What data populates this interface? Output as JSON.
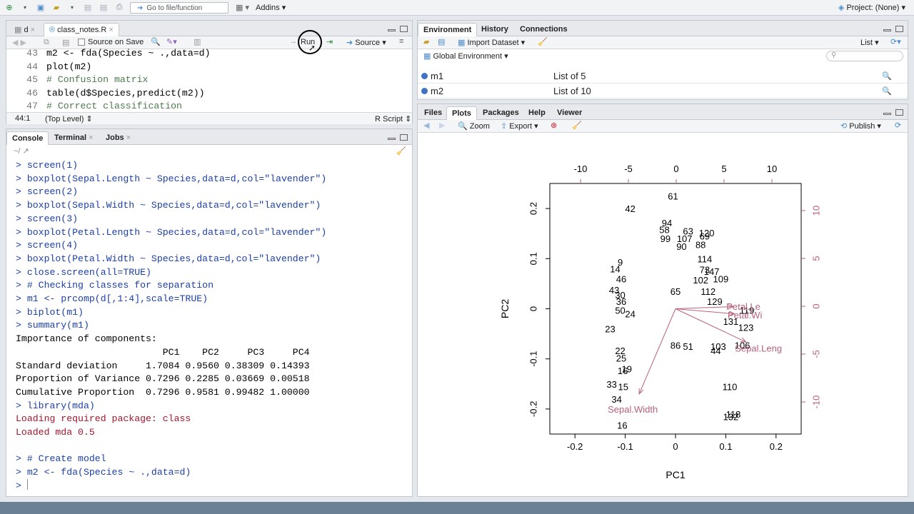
{
  "toolbar": {
    "goto_placeholder": "Go to file/function",
    "addins_label": "Addins",
    "project_label": "Project: (None)"
  },
  "editor": {
    "tabs": [
      {
        "label": "d"
      },
      {
        "label": "class_notes.R"
      }
    ],
    "source_on_save": "Source on Save",
    "run_label": "Run",
    "source_label": "Source",
    "lines": [
      {
        "num": "43",
        "text": "m2 <- fda(Species ~ .,data=d)"
      },
      {
        "num": "44",
        "text": "plot(m2)"
      },
      {
        "num": "45",
        "text": "# Confusion matrix"
      },
      {
        "num": "46",
        "text": "table(d$Species,predict(m2))"
      },
      {
        "num": "47",
        "text": "# Correct classification"
      }
    ],
    "status_pos": "44:1",
    "status_scope": "(Top Level)",
    "status_type": "R Script"
  },
  "console": {
    "tabs": [
      {
        "label": "Console"
      },
      {
        "label": "Terminal"
      },
      {
        "label": "Jobs"
      }
    ],
    "path": "~/",
    "lines": [
      {
        "kind": "in",
        "text": "> screen(1)"
      },
      {
        "kind": "in",
        "text": "> boxplot(Sepal.Length ~ Species,data=d,col=\"lavender\")"
      },
      {
        "kind": "in",
        "text": "> screen(2)"
      },
      {
        "kind": "in",
        "text": "> boxplot(Sepal.Width ~ Species,data=d,col=\"lavender\")"
      },
      {
        "kind": "in",
        "text": "> screen(3)"
      },
      {
        "kind": "in",
        "text": "> boxplot(Petal.Length ~ Species,data=d,col=\"lavender\")"
      },
      {
        "kind": "in",
        "text": "> screen(4)"
      },
      {
        "kind": "in",
        "text": "> boxplot(Petal.Width ~ Species,data=d,col=\"lavender\")"
      },
      {
        "kind": "in",
        "text": "> close.screen(all=TRUE)"
      },
      {
        "kind": "in",
        "text": "> # Checking classes for separation"
      },
      {
        "kind": "in",
        "text": "> m1 <- prcomp(d[,1:4],scale=TRUE)"
      },
      {
        "kind": "in",
        "text": "> biplot(m1)"
      },
      {
        "kind": "in",
        "text": "> summary(m1)"
      },
      {
        "kind": "out",
        "text": "Importance of components:"
      },
      {
        "kind": "out",
        "text": "                          PC1    PC2     PC3     PC4"
      },
      {
        "kind": "out",
        "text": "Standard deviation     1.7084 0.9560 0.38309 0.14393"
      },
      {
        "kind": "out",
        "text": "Proportion of Variance 0.7296 0.2285 0.03669 0.00518"
      },
      {
        "kind": "out",
        "text": "Cumulative Proportion  0.7296 0.9581 0.99482 1.00000"
      },
      {
        "kind": "in",
        "text": "> library(mda)"
      },
      {
        "kind": "msg",
        "text": "Loading required package: class"
      },
      {
        "kind": "msg",
        "text": "Loaded mda 0.5"
      },
      {
        "kind": "out",
        "text": ""
      },
      {
        "kind": "in",
        "text": "> # Create model"
      },
      {
        "kind": "in",
        "text": "> m2 <- fda(Species ~ .,data=d)"
      },
      {
        "kind": "in",
        "text": "> "
      }
    ]
  },
  "environment": {
    "tabs": [
      {
        "label": "Environment"
      },
      {
        "label": "History"
      },
      {
        "label": "Connections"
      }
    ],
    "import_label": "Import Dataset",
    "list_label": "List",
    "scope_label": "Global Environment",
    "rows": [
      {
        "name": "m1",
        "value": "List of 5"
      },
      {
        "name": "m2",
        "value": "List of 10"
      }
    ]
  },
  "files": {
    "tabs": [
      {
        "label": "Files"
      },
      {
        "label": "Plots"
      },
      {
        "label": "Packages"
      },
      {
        "label": "Help"
      },
      {
        "label": "Viewer"
      }
    ],
    "zoom_label": "Zoom",
    "export_label": "Export",
    "publish_label": "Publish"
  },
  "chart_data": {
    "type": "scatter",
    "title": "",
    "xlabel": "PC1",
    "ylabel": "PC2",
    "xlim": [
      -0.25,
      0.25
    ],
    "ylim": [
      -0.25,
      0.25
    ],
    "xticks": [
      -0.2,
      -0.1,
      0.0,
      0.1,
      0.2
    ],
    "yticks": [
      -0.2,
      -0.1,
      0.0,
      0.1,
      0.2
    ],
    "top_ticks": [
      -10,
      -5,
      0,
      5,
      10
    ],
    "right_ticks": [
      -10,
      -5,
      0,
      5,
      10
    ],
    "grid": false,
    "points": [
      {
        "label": "61",
        "x": -0.005,
        "y": 0.225
      },
      {
        "label": "42",
        "x": -0.09,
        "y": 0.2
      },
      {
        "label": "94",
        "x": -0.017,
        "y": 0.172
      },
      {
        "label": "58",
        "x": -0.022,
        "y": 0.158
      },
      {
        "label": "63",
        "x": 0.025,
        "y": 0.155
      },
      {
        "label": "120",
        "x": 0.062,
        "y": 0.152
      },
      {
        "label": "99",
        "x": -0.02,
        "y": 0.14
      },
      {
        "label": "107",
        "x": 0.018,
        "y": 0.14
      },
      {
        "label": "69",
        "x": 0.058,
        "y": 0.145
      },
      {
        "label": "88",
        "x": 0.05,
        "y": 0.128
      },
      {
        "label": "90",
        "x": 0.012,
        "y": 0.125
      },
      {
        "label": "114",
        "x": 0.058,
        "y": 0.1
      },
      {
        "label": "9",
        "x": -0.11,
        "y": 0.093
      },
      {
        "label": "14",
        "x": -0.12,
        "y": 0.08
      },
      {
        "label": "73",
        "x": 0.058,
        "y": 0.078
      },
      {
        "label": "147",
        "x": 0.072,
        "y": 0.075
      },
      {
        "label": "109",
        "x": 0.09,
        "y": 0.06
      },
      {
        "label": "102",
        "x": 0.05,
        "y": 0.058
      },
      {
        "label": "46",
        "x": -0.108,
        "y": 0.06
      },
      {
        "label": "43",
        "x": -0.122,
        "y": 0.038
      },
      {
        "label": "30",
        "x": -0.11,
        "y": 0.028
      },
      {
        "label": "36",
        "x": -0.108,
        "y": 0.015
      },
      {
        "label": "65",
        "x": 0.0,
        "y": 0.035
      },
      {
        "label": "112",
        "x": 0.065,
        "y": 0.035
      },
      {
        "label": "129",
        "x": 0.078,
        "y": 0.015
      },
      {
        "label": "119",
        "x": 0.142,
        "y": -0.003
      },
      {
        "label": "50",
        "x": -0.11,
        "y": -0.003
      },
      {
        "label": "24",
        "x": -0.09,
        "y": -0.01
      },
      {
        "label": "131",
        "x": 0.11,
        "y": -0.025
      },
      {
        "label": "23",
        "x": -0.13,
        "y": -0.04
      },
      {
        "label": "123",
        "x": 0.14,
        "y": -0.037
      },
      {
        "label": "86",
        "x": 0.0,
        "y": -0.073
      },
      {
        "label": "51",
        "x": 0.025,
        "y": -0.075
      },
      {
        "label": "103",
        "x": 0.085,
        "y": -0.075
      },
      {
        "label": "106",
        "x": 0.133,
        "y": -0.073
      },
      {
        "label": "44",
        "x": 0.08,
        "y": -0.083
      },
      {
        "label": "22",
        "x": -0.11,
        "y": -0.083
      },
      {
        "label": "25",
        "x": -0.108,
        "y": -0.098
      },
      {
        "label": "19",
        "x": -0.097,
        "y": -0.12
      },
      {
        "label": "16",
        "x": -0.105,
        "y": -0.123
      },
      {
        "label": "33",
        "x": -0.127,
        "y": -0.15
      },
      {
        "label": "15",
        "x": -0.104,
        "y": -0.155
      },
      {
        "label": "110",
        "x": 0.108,
        "y": -0.155
      },
      {
        "label": "34",
        "x": -0.117,
        "y": -0.18
      },
      {
        "label": "118",
        "x": 0.115,
        "y": -0.21
      },
      {
        "label": "132",
        "x": 0.11,
        "y": -0.215
      },
      {
        "label": "16",
        "x": -0.106,
        "y": -0.232
      }
    ],
    "arrows": [
      {
        "label": "Petal.Le",
        "x": 0.135,
        "y": 0.005
      },
      {
        "label": "Petal.Wi",
        "x": 0.138,
        "y": -0.012
      },
      {
        "label": "Sepal.Leng",
        "x": 0.165,
        "y": -0.078
      },
      {
        "label": "Sepal.Width",
        "x": -0.085,
        "y": -0.2
      }
    ],
    "arrow_color": "#b9617a"
  }
}
